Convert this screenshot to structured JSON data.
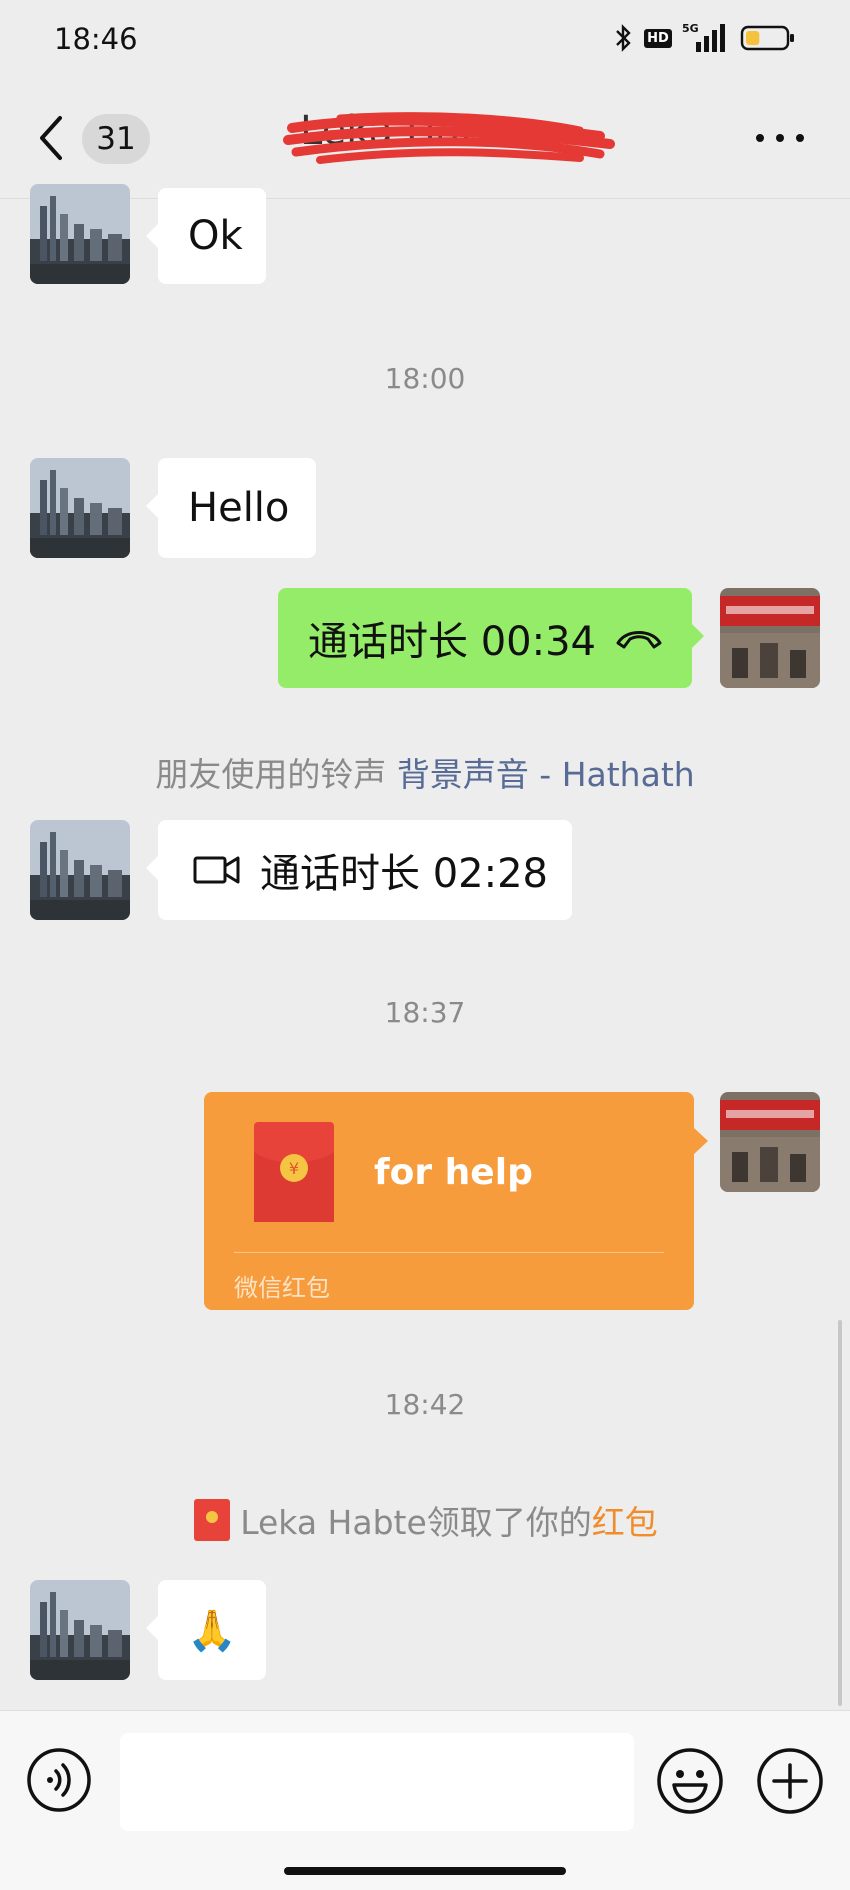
{
  "status_bar": {
    "time": "18:46",
    "hd_badge": "HD",
    "network": "5G",
    "battery_level": 0.35
  },
  "header": {
    "unread_count": "31",
    "contact_name": "Leka Habte"
  },
  "messages": {
    "m1_text": "Ok",
    "ts1": "18:00",
    "m2_text": "Hello",
    "m3_call_text": "通话时长 00:34",
    "ringtone": {
      "prefix": "朋友使用的铃声",
      "song": "背景声音 - Hathath"
    },
    "m4_video_call_text": "通话时长 02:28",
    "ts2": "18:37",
    "red_packet": {
      "title": "for help",
      "label": "微信红包"
    },
    "ts3": "18:42",
    "claim": {
      "prefix": "Leka Habte领取了你的",
      "highlight": "红包"
    },
    "m5_emoji": "🙏"
  },
  "input": {
    "placeholder": ""
  },
  "colors": {
    "bubble_self": "#95ec69",
    "red_packet": "#f79c3c",
    "link": "#576b95",
    "highlight": "#f08c29"
  }
}
